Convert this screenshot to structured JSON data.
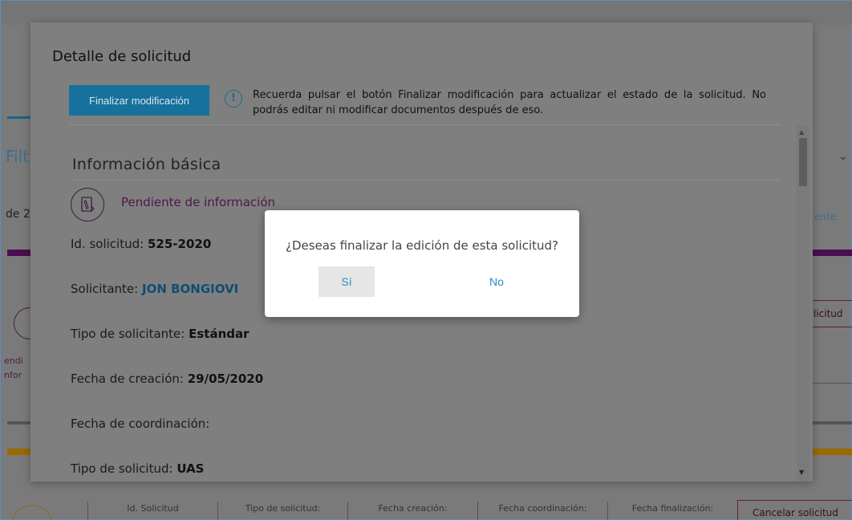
{
  "background": {
    "filter_label": "Filt",
    "count_prefix": "de 2",
    "right_label": "ente",
    "status_label_1": "endi",
    "status_label_2": "nfor",
    "right_button_label": "licitud",
    "cancel_button_label": "Cancelar solicitud",
    "table_headers": [
      "Id. Solicitud",
      "Tipo de solicitud:",
      "Fecha creación:",
      "Fecha coordinación:",
      "Fecha finalización:"
    ],
    "colors": {
      "purple_band": "#4a0e4e",
      "orange_band": "#9a6a00"
    }
  },
  "modal": {
    "title": "Detalle de solicitud",
    "finalize_button": "Finalizar modificación",
    "info_icon": "info-circle-icon",
    "info_text": "Recuerda pulsar el botón Finalizar modificación para actualizar el estado de la solicitud. No podrás editar ni modificar documentos después de eso.",
    "section_title": "Información básica",
    "status": {
      "icon": "document-edit-icon",
      "label": "Pendiente de información"
    },
    "fields": [
      {
        "label": "Id. solicitud:",
        "value": "525-2020"
      },
      {
        "label": "Solicitante:",
        "value": "JON BONGIOVI"
      },
      {
        "label": "Tipo de solicitante:",
        "value": "Estándar"
      },
      {
        "label": "Fecha de creación:",
        "value": "29/05/2020"
      },
      {
        "label": "Fecha de coordinación:",
        "value": ""
      },
      {
        "label": "Tipo de solicitud:",
        "value": "UAS"
      }
    ]
  },
  "dialog": {
    "question": "¿Deseas finalizar la edición de esta solicitud?",
    "yes_label": "Sí",
    "no_label": "No"
  },
  "colors": {
    "accent": "#16719c",
    "link": "#2a8bc0"
  }
}
